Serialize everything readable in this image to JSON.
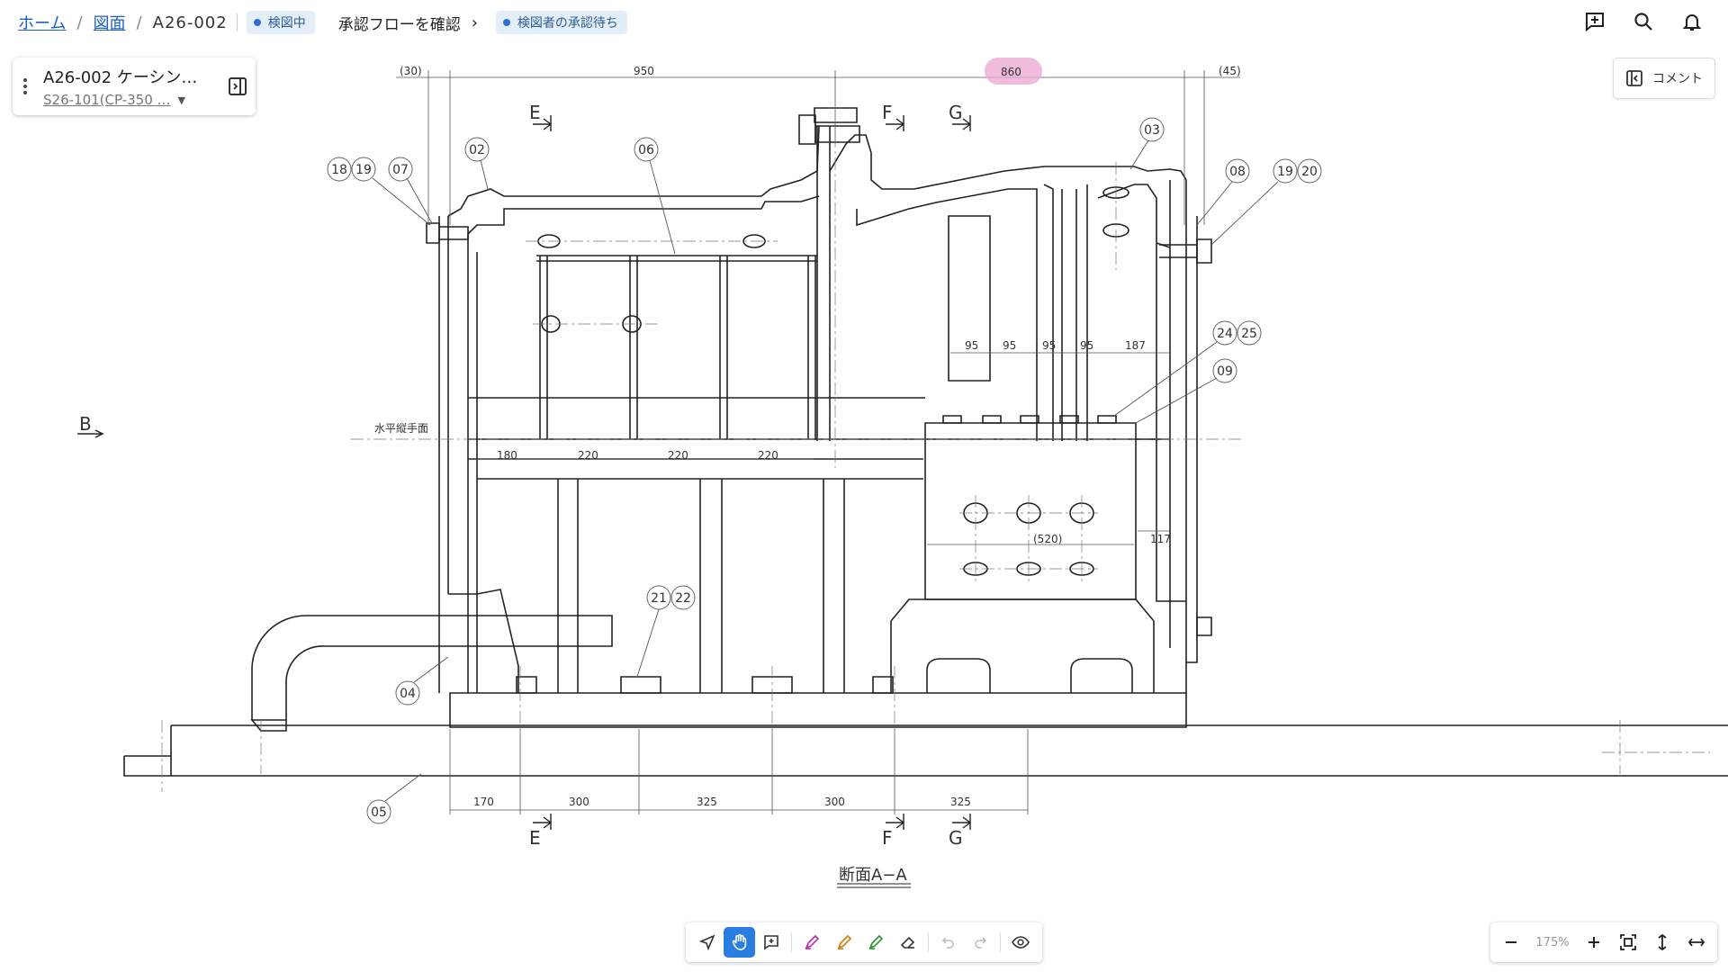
{
  "breadcrumb": {
    "home": "ホーム",
    "drawings": "図面",
    "current": "A26-002",
    "separator": "/"
  },
  "status_badge": "検図中",
  "approval_flow_link": "承認フローを確認",
  "pending_badge": "検図者の承認待ち",
  "document": {
    "title": "A26-002 ケーシン…",
    "subtitle": "S26-101(CP-350 …"
  },
  "comment_button": "コメント",
  "toolbar": {
    "active_tool": "pan"
  },
  "zoom": {
    "value": "175%"
  },
  "drawing": {
    "section_title": "断面A−A",
    "horizontal_plane_label": "水平縦手面",
    "top_dims": [
      "(30)",
      "950",
      "860",
      "(45)"
    ],
    "section_marks": [
      "E",
      "F",
      "G",
      "B"
    ],
    "balloons": [
      "18",
      "19",
      "07",
      "02",
      "06",
      "03",
      "08",
      "19",
      "20",
      "24",
      "25",
      "09",
      "21",
      "22",
      "04",
      "05"
    ],
    "inner_dims_top": [
      "95",
      "95",
      "95",
      "95",
      "187"
    ],
    "inner_dims_mid": [
      "180",
      "220",
      "220",
      "220"
    ],
    "box_dim": "(520)",
    "side_dim": "117",
    "bottom_dims": [
      "170",
      "300",
      "325",
      "300",
      "325"
    ]
  },
  "colors": {
    "accent": "#2a7de1",
    "link": "#1f5fbf",
    "badge_bg": "#e4eef9",
    "highlight": "#e9a6cf"
  }
}
